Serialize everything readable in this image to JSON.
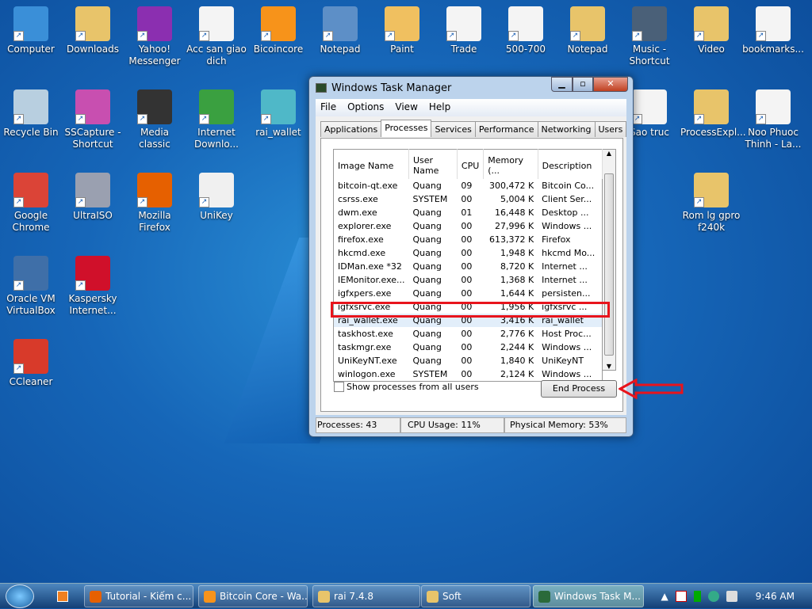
{
  "desktop_icons": [
    {
      "label": "Computer",
      "color": "#3a8fd8"
    },
    {
      "label": "Downloads",
      "color": "#e8c46a"
    },
    {
      "label": "Yahoo! Messenger",
      "color": "#8b2fb0"
    },
    {
      "label": "Acc san giao dich",
      "color": "#f4f4f4"
    },
    {
      "label": "Bicoincore",
      "color": "#f7931a"
    },
    {
      "label": "Notepad",
      "color": "#5d8fc7"
    },
    {
      "label": "Paint",
      "color": "#f0c060"
    },
    {
      "label": "Trade",
      "color": "#f4f4f4"
    },
    {
      "label": "500-700",
      "color": "#f4f4f4"
    },
    {
      "label": "Notepad",
      "color": "#e8c46a"
    },
    {
      "label": "Music - Shortcut",
      "color": "#4a6078"
    },
    {
      "label": "Video",
      "color": "#e8c46a"
    },
    {
      "label": "bookmarks...",
      "color": "#f4f4f4"
    },
    {
      "label": "Recycle Bin",
      "color": "#b8cfe0"
    },
    {
      "label": "SSCapture - Shortcut",
      "color": "#c84fb0"
    },
    {
      "label": "Media classic",
      "color": "#333333"
    },
    {
      "label": "Internet Downlo...",
      "color": "#3aa040"
    },
    {
      "label": "rai_wallet",
      "color": "#4fb8c8"
    },
    {
      "label": "Sao truc",
      "color": "#f4f4f4"
    },
    {
      "label": "ProcessExpl...",
      "color": "#e8c46a"
    },
    {
      "label": "Noo Phuoc Thinh - La...",
      "color": "#f4f4f4"
    },
    {
      "label": "Google Chrome",
      "color": "#db4437"
    },
    {
      "label": "UltraISO",
      "color": "#9aa0b0"
    },
    {
      "label": "Mozilla Firefox",
      "color": "#e66000"
    },
    {
      "label": "UniKey",
      "color": "#f0f0f0"
    },
    {
      "label": "Rom lg gpro f240k",
      "color": "#e8c46a"
    },
    {
      "label": "Oracle VM VirtualBox",
      "color": "#3f6fa8"
    },
    {
      "label": "Kaspersky Internet...",
      "color": "#d0102a"
    },
    {
      "label": "CCleaner",
      "color": "#d83a2a"
    }
  ],
  "window": {
    "title": "Windows Task Manager",
    "menu": [
      "File",
      "Options",
      "View",
      "Help"
    ],
    "tabs": [
      "Applications",
      "Processes",
      "Services",
      "Performance",
      "Networking",
      "Users"
    ],
    "active_tab": "Processes",
    "columns": [
      "Image Name",
      "User Name",
      "CPU",
      "Memory (...",
      "Description"
    ],
    "rows": [
      [
        "bitcoin-qt.exe",
        "Quang",
        "09",
        "300,472 K",
        "Bitcoin Co..."
      ],
      [
        "csrss.exe",
        "SYSTEM",
        "00",
        "5,004 K",
        "Client Ser..."
      ],
      [
        "dwm.exe",
        "Quang",
        "01",
        "16,448 K",
        "Desktop ..."
      ],
      [
        "explorer.exe",
        "Quang",
        "00",
        "27,996 K",
        "Windows ..."
      ],
      [
        "firefox.exe",
        "Quang",
        "00",
        "613,372 K",
        "Firefox"
      ],
      [
        "hkcmd.exe",
        "Quang",
        "00",
        "1,948 K",
        "hkcmd Mo..."
      ],
      [
        "IDMan.exe *32",
        "Quang",
        "00",
        "8,720 K",
        "Internet ..."
      ],
      [
        "IEMonitor.exe...",
        "Quang",
        "00",
        "1,368 K",
        "Internet ..."
      ],
      [
        "igfxpers.exe",
        "Quang",
        "00",
        "1,644 K",
        "persisten..."
      ],
      [
        "igfxsrvc.exe",
        "Quang",
        "00",
        "1,956 K",
        "igfxsrvc ..."
      ],
      [
        "rai_wallet.exe",
        "Quang",
        "00",
        "3,416 K",
        "rai_wallet"
      ],
      [
        "taskhost.exe",
        "Quang",
        "00",
        "2,776 K",
        "Host Proc..."
      ],
      [
        "taskmgr.exe",
        "Quang",
        "00",
        "2,244 K",
        "Windows ..."
      ],
      [
        "UniKeyNT.exe",
        "Quang",
        "00",
        "1,840 K",
        "UniKeyNT"
      ],
      [
        "winlogon.exe",
        "SYSTEM",
        "00",
        "2,124 K",
        "Windows ..."
      ]
    ],
    "selected_row": 10,
    "show_all_label": "Show processes from all users",
    "end_process_label": "End Process",
    "status": {
      "processes": "Processes: 43",
      "cpu": "CPU Usage: 11%",
      "memory": "Physical Memory: 53%"
    }
  },
  "taskbar": {
    "items": [
      {
        "label": "Tutorial - Kiếm c...",
        "color": "#e66000"
      },
      {
        "label": "Bitcoin Core - Wa...",
        "color": "#f7931a"
      },
      {
        "label": "rai 7.4.8",
        "color": "#e8c46a"
      },
      {
        "label": "Soft",
        "color": "#e8c46a"
      },
      {
        "label": "Windows Task M...",
        "color": "#2a6a3a"
      }
    ],
    "clock": "9:46 AM"
  }
}
